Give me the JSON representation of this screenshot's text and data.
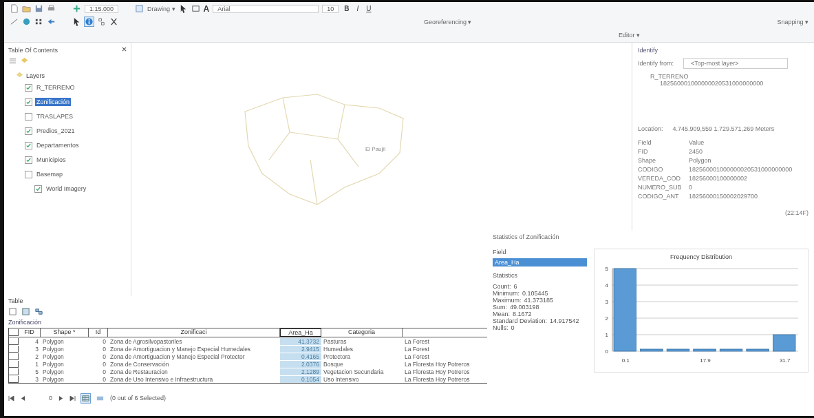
{
  "toolbar": {
    "scale": "1:15.000",
    "drawing_menu": "Drawing ▾",
    "font": "Arial",
    "font_size": "10",
    "georeferencing_menu": "Georeferencing ▾",
    "editor_menu": "Editor ▾",
    "snapping_menu": "Snapping ▾",
    "text_tool": "A",
    "format_buttons": [
      "B",
      "I",
      "U"
    ]
  },
  "toc": {
    "title": "Table Of Contents",
    "root": "Layers",
    "layers": [
      {
        "label": "R_TERRENO",
        "checked": true,
        "selected": false
      },
      {
        "label": "Zonificación",
        "checked": true,
        "selected": true
      },
      {
        "label": "TRASLAPES",
        "checked": false,
        "selected": false
      },
      {
        "label": "Predios_2021",
        "checked": true,
        "selected": false
      },
      {
        "label": "Departamentos",
        "checked": true,
        "selected": false
      },
      {
        "label": "Municipios",
        "checked": true,
        "selected": false
      },
      {
        "label": "Basemap",
        "checked": false,
        "selected": false,
        "children": [
          {
            "label": "World Imagery",
            "checked": true,
            "selected": false
          }
        ]
      }
    ]
  },
  "map": {
    "place_label": "El Paujil"
  },
  "identify": {
    "title": "Identify",
    "from_label": "Identify from:",
    "from_value": "<Top-most layer>",
    "layer": "R_TERRENO",
    "feature": "182560001000000020531000000000",
    "location_label": "Location:",
    "location": "4.745.909,559  1.729.571,269 Meters",
    "field_header": "Field",
    "value_header": "Value",
    "fields": [
      {
        "field": "FID",
        "value": "2450"
      },
      {
        "field": "Shape",
        "value": "Polygon"
      },
      {
        "field": "CODIGO",
        "value": "182560001000000020531000000000"
      },
      {
        "field": "VEREDA_COD",
        "value": "18256000100000002"
      },
      {
        "field": "NUMERO_SUB",
        "value": "0"
      },
      {
        "field": "CODIGO_ANT",
        "value": "18256000150002029700"
      }
    ],
    "footer": "(22:14F)"
  },
  "table": {
    "title": "Table",
    "tab": "Zonificación",
    "columns": [
      "FID",
      "Shape *",
      "Id",
      "Zonificaci",
      "Area_Ha",
      "Categoria"
    ],
    "rows": [
      {
        "cells": [
          "4",
          "Polygon",
          "0",
          "Zona de Agrosilvopastoriles",
          "41.3732",
          "Pasturas",
          "La Forest"
        ]
      },
      {
        "cells": [
          "3",
          "Polygon",
          "0",
          "Zona de Amortiguacion y Manejo Especial Humedales",
          "2.9415",
          "Humedales",
          "La Forest"
        ]
      },
      {
        "cells": [
          "2",
          "Polygon",
          "0",
          "Zona de Amortiguacion y Manejo Especial Protector",
          "0.4165",
          "Protectora",
          "La Forest"
        ]
      },
      {
        "cells": [
          "1",
          "Polygon",
          "0",
          "Zona de Conservación",
          "2.0376",
          "Bosque",
          "La Floresta Hoy Potreros"
        ]
      },
      {
        "cells": [
          "5",
          "Polygon",
          "0",
          "Zona de Restauracion",
          "2.1289",
          "Vegetacion Secundaria",
          "La Floresta Hoy Potreros"
        ]
      },
      {
        "cells": [
          "3",
          "Polygon",
          "0",
          "Zona de Uso Intensivo e Infraestructura",
          "0.1054",
          "Uso Intensivo",
          "La Floresta Hoy Potreros"
        ]
      }
    ],
    "record": "0",
    "status": "(0 out of 6 Selected)"
  },
  "statistics": {
    "title": "Statistics of Zonificación",
    "field_label": "Field",
    "field_value": "Area_Ha",
    "stats_label": "Statistics",
    "stats": [
      {
        "name": "Count:",
        "value": "6"
      },
      {
        "name": "Minimum:",
        "value": "0.105445"
      },
      {
        "name": "Maximum:",
        "value": "41.373185"
      },
      {
        "name": "Sum:",
        "value": "49.003198"
      },
      {
        "name": "Mean:",
        "value": "8.1672"
      },
      {
        "name": "Standard Deviation:",
        "value": "14.917542"
      },
      {
        "name": "Nulls:",
        "value": "0"
      }
    ],
    "chart_data": {
      "type": "bar",
      "title": "Frequency Distribution",
      "categories": [
        "0.1",
        null,
        null,
        "17.9",
        null,
        null,
        "31.7"
      ],
      "values": [
        5,
        0,
        0,
        0,
        0,
        0,
        1
      ],
      "yticks": [
        0,
        1,
        2,
        3,
        4,
        5
      ],
      "ylim": [
        0,
        5
      ],
      "grid": true
    }
  }
}
